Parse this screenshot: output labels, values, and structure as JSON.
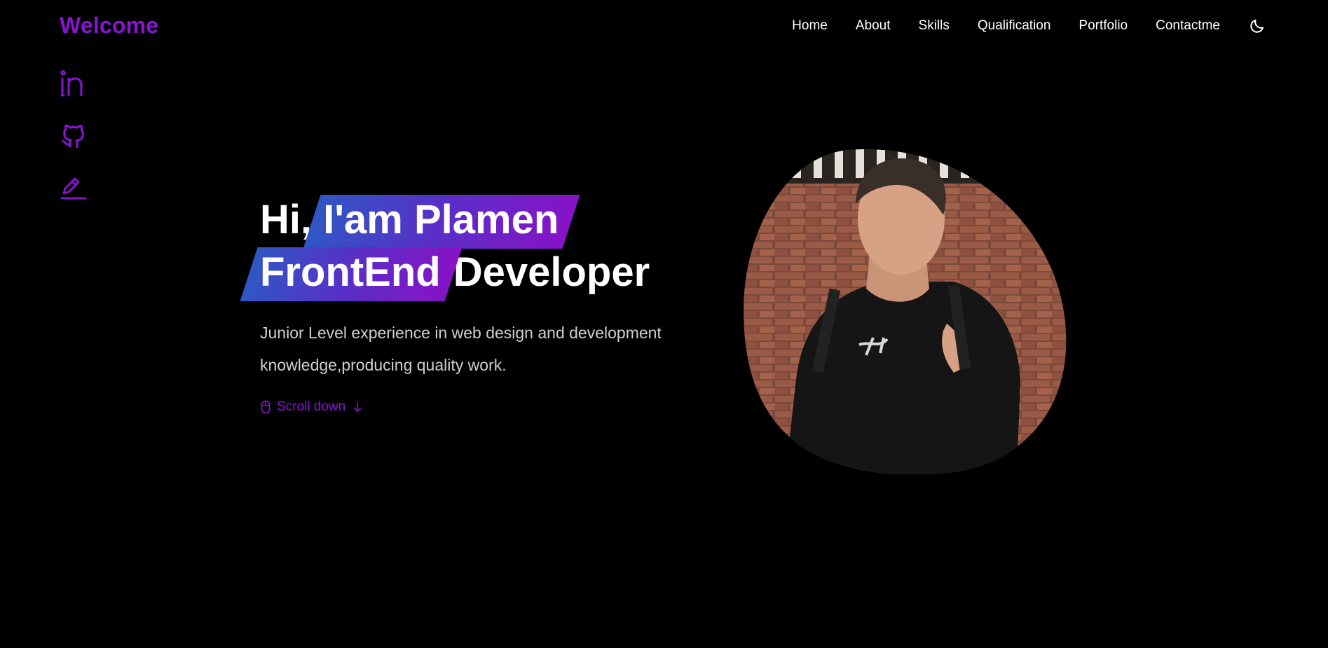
{
  "header": {
    "logo": "Welcome",
    "nav": [
      {
        "label": "Home"
      },
      {
        "label": "About"
      },
      {
        "label": "Skills"
      },
      {
        "label": "Qualification"
      },
      {
        "label": "Portfolio"
      },
      {
        "label": "Contactme"
      }
    ],
    "theme_icon": "moon-icon"
  },
  "social": [
    {
      "icon": "linkedin-icon"
    },
    {
      "icon": "github-icon"
    },
    {
      "icon": "pencil-icon"
    }
  ],
  "hero": {
    "greeting": "Hi,",
    "name_highlight": "I'am Plamen",
    "role_highlight": "FrontEnd",
    "role_rest": "Developer",
    "description": "Junior Level experience in web design and development knowledge,producing quality work.",
    "scroll_label": "Scroll down"
  },
  "colors": {
    "accent": "#8a14d4",
    "gradient_start": "#2f57c4",
    "gradient_end": "#8713c6",
    "background": "#000000"
  }
}
